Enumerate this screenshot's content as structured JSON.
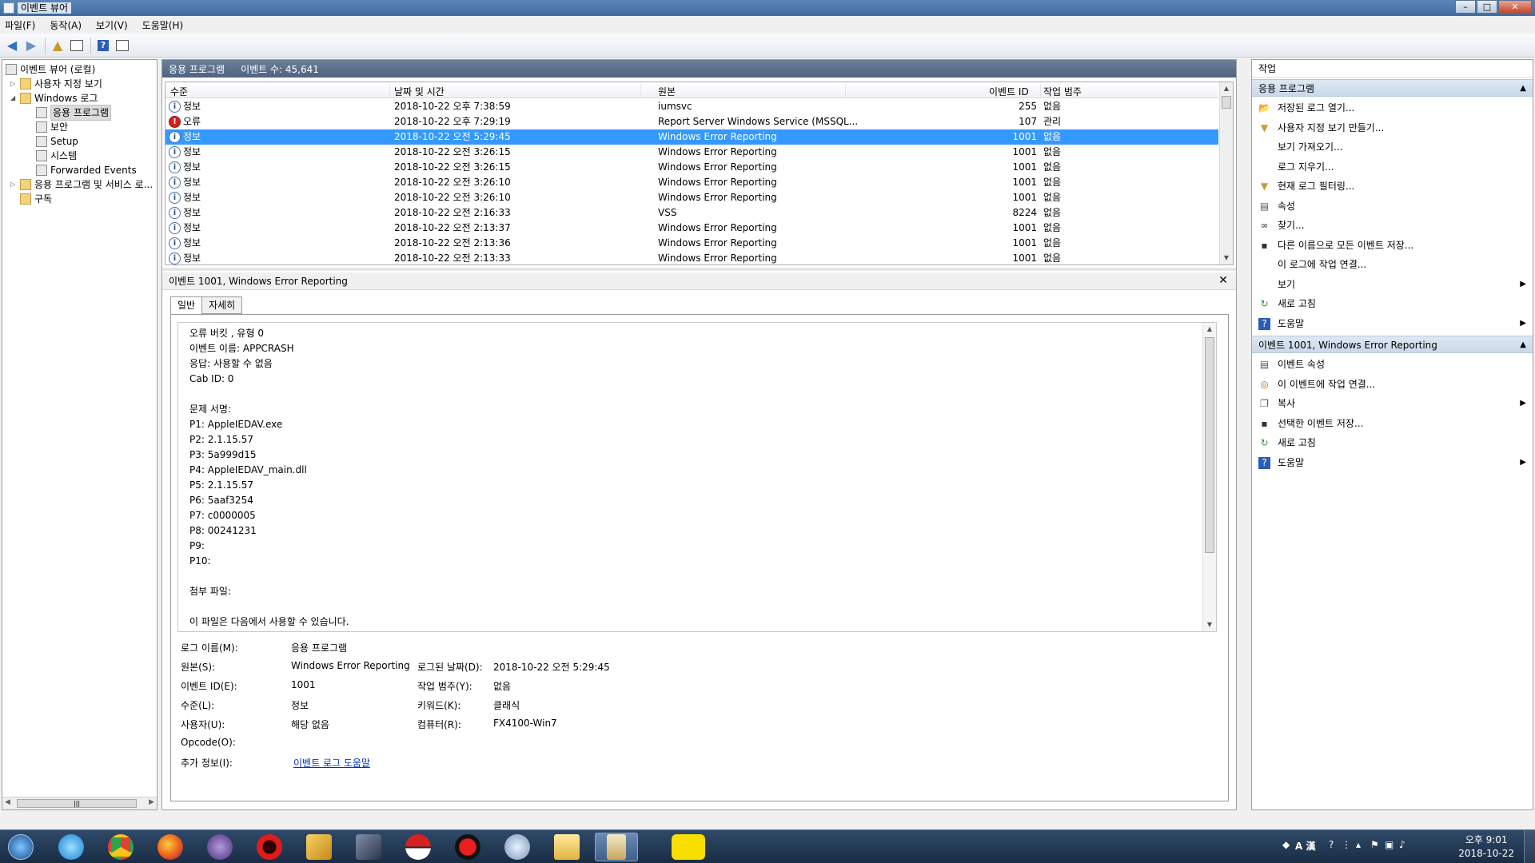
{
  "window": {
    "title": "이벤트 뷰어"
  },
  "menu": [
    "파일(F)",
    "동작(A)",
    "보기(V)",
    "도움말(H)"
  ],
  "tree": {
    "root": "이벤트 뷰어 (로컬)",
    "custom_views": "사용자 지정 보기",
    "windows_logs": "Windows 로그",
    "logs": [
      "응용 프로그램",
      "보안",
      "Setup",
      "시스템",
      "Forwarded Events"
    ],
    "apps_services": "응용 프로그램 및 서비스 로...",
    "subscriptions": "구독"
  },
  "list": {
    "header_title": "응용 프로그램",
    "event_count": "이벤트 수: 45,641",
    "columns": [
      "수준",
      "날짜 및 시간",
      "원본",
      "이벤트 ID",
      "작업 범주"
    ],
    "rows": [
      {
        "level": "정보",
        "type": "info",
        "datetime": "2018-10-22 오후 7:38:59",
        "source": "iumsvc",
        "id": "255",
        "category": "없음"
      },
      {
        "level": "오류",
        "type": "err",
        "datetime": "2018-10-22 오후 7:29:19",
        "source": "Report Server Windows Service (MSSQL...",
        "id": "107",
        "category": "관리"
      },
      {
        "level": "정보",
        "type": "info",
        "datetime": "2018-10-22 오전 5:29:45",
        "source": "Windows Error Reporting",
        "id": "1001",
        "category": "없음",
        "selected": true
      },
      {
        "level": "정보",
        "type": "info",
        "datetime": "2018-10-22 오전 3:26:15",
        "source": "Windows Error Reporting",
        "id": "1001",
        "category": "없음"
      },
      {
        "level": "정보",
        "type": "info",
        "datetime": "2018-10-22 오전 3:26:15",
        "source": "Windows Error Reporting",
        "id": "1001",
        "category": "없음"
      },
      {
        "level": "정보",
        "type": "info",
        "datetime": "2018-10-22 오전 3:26:10",
        "source": "Windows Error Reporting",
        "id": "1001",
        "category": "없음"
      },
      {
        "level": "정보",
        "type": "info",
        "datetime": "2018-10-22 오전 3:26:10",
        "source": "Windows Error Reporting",
        "id": "1001",
        "category": "없음"
      },
      {
        "level": "정보",
        "type": "info",
        "datetime": "2018-10-22 오전 2:16:33",
        "source": "VSS",
        "id": "8224",
        "category": "없음"
      },
      {
        "level": "정보",
        "type": "info",
        "datetime": "2018-10-22 오전 2:13:37",
        "source": "Windows Error Reporting",
        "id": "1001",
        "category": "없음"
      },
      {
        "level": "정보",
        "type": "info",
        "datetime": "2018-10-22 오전 2:13:36",
        "source": "Windows Error Reporting",
        "id": "1001",
        "category": "없음"
      },
      {
        "level": "정보",
        "type": "info",
        "datetime": "2018-10-22 오전 2:13:33",
        "source": "Windows Error Reporting",
        "id": "1001",
        "category": "없음"
      }
    ]
  },
  "detail": {
    "title": "이벤트 1001, Windows Error Reporting",
    "tabs": [
      "일반",
      "자세히"
    ],
    "description": [
      "오류 버킷 , 유형 0",
      "이벤트 이름: APPCRASH",
      "응답: 사용할 수 없음",
      "Cab ID: 0",
      "",
      "문제 서명:",
      "P1: AppleIEDAV.exe",
      "P2: 2.1.15.57",
      "P3: 5a999d15",
      "P4: AppleIEDAV_main.dll",
      "P5: 2.1.15.57",
      "P6: 5aaf3254",
      "P7: c0000005",
      "P8: 00241231",
      "P9:",
      "P10:",
      "",
      "첨부 파일:",
      "",
      "이 파일은 다음에서 사용할 수 있습니다."
    ],
    "fields": {
      "log_name_label": "로그 이름(M):",
      "log_name": "응용 프로그램",
      "source_label": "원본(S):",
      "source": "Windows Error Reporting",
      "logged_label": "로그된 날짜(D):",
      "logged": "2018-10-22 오전 5:29:45",
      "event_id_label": "이벤트 ID(E):",
      "event_id": "1001",
      "task_cat_label": "작업 범주(Y):",
      "task_cat": "없음",
      "level_label": "수준(L):",
      "level": "정보",
      "keywords_label": "키워드(K):",
      "keywords": "클래식",
      "user_label": "사용자(U):",
      "user": "해당 없음",
      "computer_label": "컴퓨터(R):",
      "computer": "FX4100-Win7",
      "opcode_label": "Opcode(O):",
      "more_info_label": "추가 정보(I):",
      "more_info_link": "이벤트 로그 도움말"
    }
  },
  "actions": {
    "header": "작업",
    "section1": "응용 프로그램",
    "items1": [
      "저장된 로그 열기...",
      "사용자 지정 보기 만들기...",
      "보기 가져오기...",
      "로그 지우기...",
      "현재 로그 필터링...",
      "속성",
      "찾기...",
      "다른 이름으로 모든 이벤트 저장...",
      "이 로그에 작업 연결...",
      "보기",
      "새로 고침",
      "도움말"
    ],
    "section2": "이벤트 1001, Windows Error Reporting",
    "items2": [
      "이벤트 속성",
      "이 이벤트에 작업 연결...",
      "복사",
      "선택한 이벤트 저장...",
      "새로 고침",
      "도움말"
    ]
  },
  "taskbar": {
    "ime": "A 漢",
    "time": "오후 9:01",
    "date": "2018-10-22"
  }
}
